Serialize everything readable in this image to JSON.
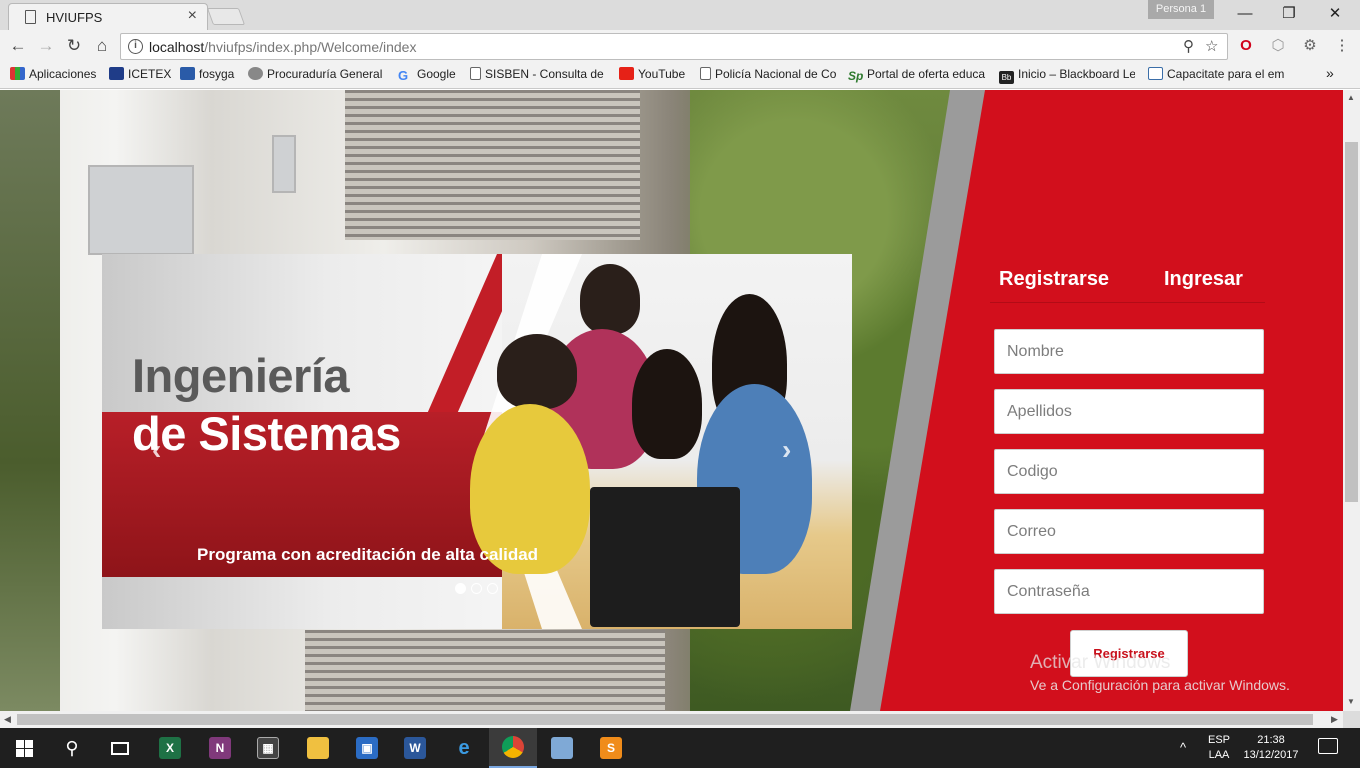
{
  "browser": {
    "tab_title": "HVIUFPS",
    "tab_close": "×",
    "profile": "Persona 1",
    "win_min": "—",
    "win_max": "❐",
    "win_close": "✕",
    "url_host": "localhost",
    "url_path": "/hviufps/index.php/Welcome/index",
    "back": "←",
    "forward": "→",
    "reload": "↻",
    "home": "⌂",
    "menu": "⋮",
    "star": "☆",
    "key": "⚲"
  },
  "bookmarks": [
    {
      "label": "Aplicaciones",
      "color": "#d33"
    },
    {
      "label": "ICETEX",
      "color": "#1f3c88"
    },
    {
      "label": "fosyga",
      "color": "#2a5ba8"
    },
    {
      "label": "Procuraduría General",
      "color": "#555"
    },
    {
      "label": "Google",
      "color": "#4285f4"
    },
    {
      "label": "SISBEN - Consulta de",
      "color": "#888"
    },
    {
      "label": "YouTube",
      "color": "#e62117"
    },
    {
      "label": "Policía Nacional de Co",
      "color": "#888"
    },
    {
      "label": "Portal de oferta educa",
      "color": "#2f7a2f"
    },
    {
      "label": "Inicio – Blackboard Le",
      "color": "#222"
    },
    {
      "label": "Capacitate para el em",
      "color": "#3b6ea8"
    }
  ],
  "bookmarks_more": "»",
  "carousel": {
    "heading_line1": "Ingeniería",
    "heading_line2": "de Sistemas",
    "subtitle": "Programa con acreditación de alta calidad",
    "prev": "‹",
    "next": "›",
    "active_slide": 1,
    "slide_count": 3
  },
  "form": {
    "tab_register": "Registrarse",
    "tab_login": "Ingresar",
    "fields": [
      {
        "placeholder": "Nombre"
      },
      {
        "placeholder": "Apellidos"
      },
      {
        "placeholder": "Codigo"
      },
      {
        "placeholder": "Correo"
      },
      {
        "placeholder": "Contraseña"
      }
    ],
    "submit": "Registrarse"
  },
  "watermark": {
    "line1": "Activar Windows",
    "line2": "Ve a Configuración para activar Windows."
  },
  "taskbar": {
    "lang_top": "ESP",
    "lang_bottom": "LAA",
    "time": "21:38",
    "date": "13/12/2017",
    "caret": "^"
  },
  "colors": {
    "brand_red": "#d20f1c",
    "button_text": "#c8101b"
  }
}
